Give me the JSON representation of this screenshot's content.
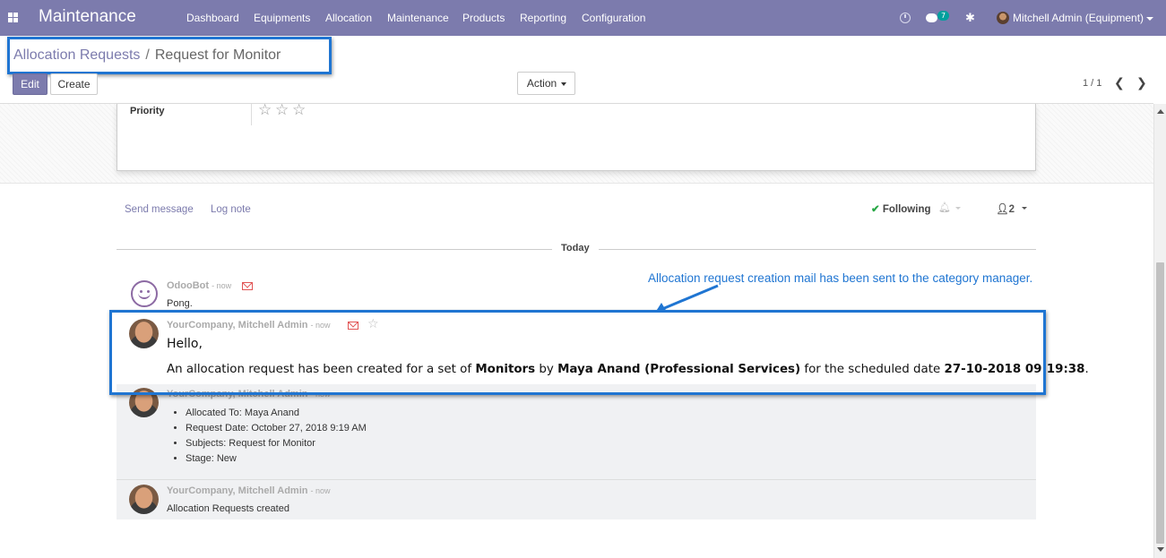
{
  "navbar": {
    "app_name": "Maintenance",
    "menu": [
      "Dashboard",
      "Equipments",
      "Allocation",
      "Maintenance",
      "Products",
      "Reporting",
      "Configuration"
    ],
    "chat_badge": "7",
    "user": "Mitchell Admin (Equipment)",
    "color": "#7c7bad"
  },
  "breadcrumb": {
    "parent": "Allocation Requests",
    "separator": "/",
    "current": "Request for Monitor"
  },
  "toolbar": {
    "edit_label": "Edit",
    "create_label": "Create",
    "action_label": "Action",
    "pager": "1 / 1"
  },
  "form": {
    "priority_label": "Priority",
    "priority_stars": 0,
    "priority_max": 3
  },
  "chatter": {
    "send_message": "Send message",
    "log_note": "Log note",
    "following": "Following",
    "followers_count": "2",
    "today": "Today",
    "messages": [
      {
        "author": "OdooBot",
        "date": "now",
        "body": "Pong."
      },
      {
        "author": "YourCompany, Mitchell Admin",
        "date": "now",
        "hello": "Hello,",
        "line_prefix": "An allocation request has been created for a set of ",
        "item": "Monitors",
        "by": " by ",
        "person": "Maya Anand (Professional Services)",
        "date_prefix": " for the scheduled date ",
        "scheduled": "27-10-2018 09:19:38",
        "suffix": "."
      },
      {
        "author": "YourCompany, Mitchell Admin",
        "date": "now",
        "bullets": [
          "Allocated To: Maya Anand",
          "Request Date: October 27, 2018 9:19 AM",
          "Subjects: Request for Monitor",
          "Stage: New"
        ]
      },
      {
        "author": "YourCompany, Mitchell Admin",
        "date": "now",
        "body": "Allocation Requests created"
      }
    ]
  },
  "annotation": "Allocation request creation mail has been sent to the category manager.",
  "highlight_color": "#1f75d2"
}
